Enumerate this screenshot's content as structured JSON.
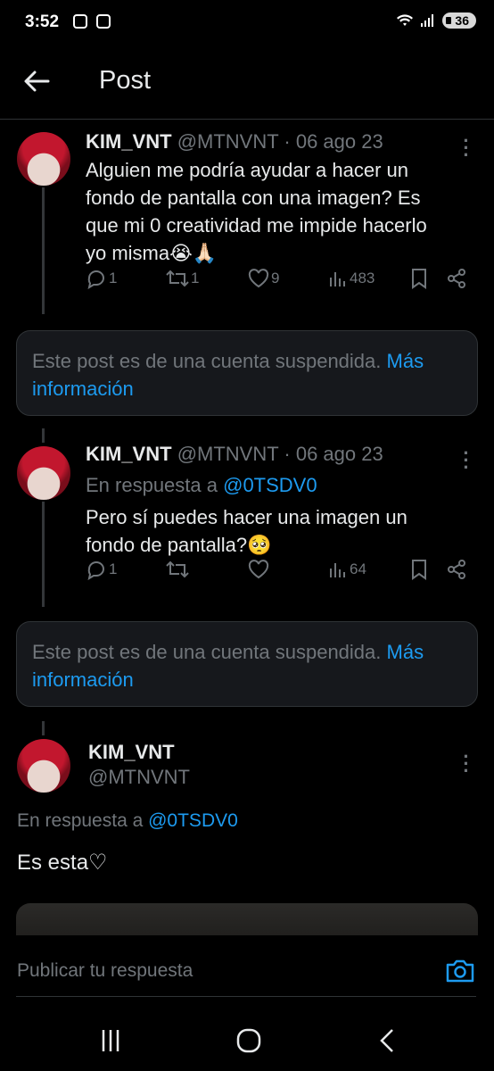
{
  "status_bar": {
    "time": "3:52",
    "battery": "36"
  },
  "header": {
    "title": "Post"
  },
  "posts": [
    {
      "name": "KIM_VNT",
      "handle": "@MTNVNT",
      "date": "· 06 ago 23",
      "text": "Alguien me podría ayudar a hacer un fondo de pantalla con una imagen? Es que mi 0 creatividad me impide hacerlo yo misma😭🙏🏻",
      "replies": "1",
      "reposts": "1",
      "likes": "9",
      "views": "483"
    },
    {
      "name": "KIM_VNT",
      "handle": "@MTNVNT",
      "date": "· 06 ago 23",
      "reply_prefix": "En respuesta a",
      "reply_handle": "@0TSDV0",
      "text": "Pero sí puedes hacer una imagen un fondo de pantalla?🥺",
      "replies": "1",
      "reposts": "",
      "likes": "",
      "views": "64"
    }
  ],
  "suspended_notice": {
    "text": "Este post es de una cuenta suspendida.",
    "link": "Más información"
  },
  "main_post": {
    "name": "KIM_VNT",
    "handle": "@MTNVNT",
    "reply_prefix": "En respuesta a",
    "reply_handle": "@0TSDV0",
    "text": "Es esta♡"
  },
  "composer": {
    "placeholder": "Publicar tu respuesta"
  },
  "colors": {
    "background": "#000000",
    "accent": "#1d9bf0",
    "muted": "#71767b",
    "border": "#2f3336"
  }
}
